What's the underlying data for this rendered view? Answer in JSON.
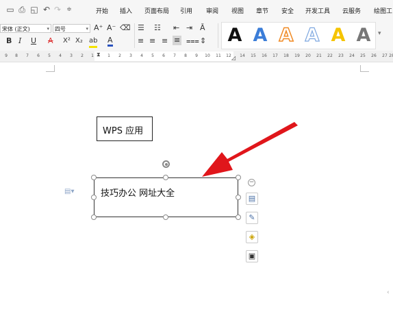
{
  "menu": {
    "items": [
      "开始",
      "插入",
      "页面布局",
      "引用",
      "审阅",
      "视图",
      "章节",
      "安全",
      "开发工具",
      "云服务",
      "绘图工"
    ]
  },
  "quick_access": {
    "icons": [
      "save-icon",
      "print-icon",
      "print-preview-icon",
      "undo-icon",
      "redo-icon",
      "customize-dropdown-icon"
    ]
  },
  "ribbon": {
    "font_name": "宋体 (正文)",
    "font_size": "四号",
    "grow_font": "A⁺",
    "shrink_font": "A⁻",
    "bold": "B",
    "italic": "I",
    "underline": "U",
    "strike": "A",
    "superscript": "X²",
    "subscript": "X₂",
    "highlight": "ab",
    "font_color": "A",
    "text_effects": [
      "A",
      "A",
      "A",
      "A",
      "A",
      "A"
    ]
  },
  "colors": {
    "accent_red": "#e0161b",
    "art_blue": "#3b7dd8",
    "art_orange": "#f08a24",
    "art_gold": "#f5c400",
    "art_gray": "#777777"
  },
  "ruler": {
    "left_numbers": [
      "9",
      "8",
      "7",
      "6",
      "5",
      "4",
      "3",
      "2",
      "1"
    ],
    "right_numbers": [
      "1",
      "2",
      "3",
      "4",
      "5",
      "6",
      "7",
      "8",
      "9",
      "10",
      "11",
      "12"
    ],
    "far_numbers": [
      "14",
      "15",
      "16",
      "17",
      "18",
      "19",
      "20",
      "21",
      "22",
      "23",
      "24",
      "25",
      "26",
      "27",
      "28"
    ]
  },
  "document": {
    "box1_text": "WPS 应用",
    "box2_text": "技巧办公  网址大全"
  }
}
